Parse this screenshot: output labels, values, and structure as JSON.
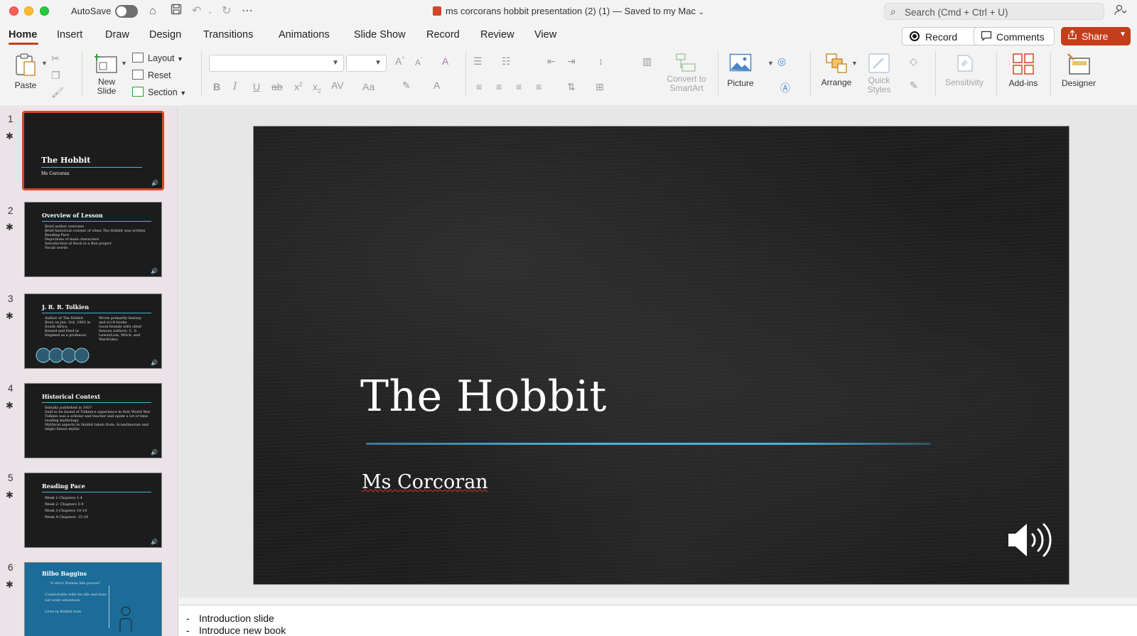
{
  "titlebar": {
    "autosave_label": "AutoSave",
    "autosave_on": false,
    "document_title": "ms corcorans hobbit presentation (2) (1)",
    "save_status": "— Saved to my Mac",
    "search_placeholder": "Search (Cmd + Ctrl + U)"
  },
  "tabs": [
    "Home",
    "Insert",
    "Draw",
    "Design",
    "Transitions",
    "Animations",
    "Slide Show",
    "Record",
    "Review",
    "View"
  ],
  "active_tab": "Home",
  "actions": {
    "record_label": "Record",
    "comments_label": "Comments",
    "share_label": "Share"
  },
  "ribbon": {
    "paste": "Paste",
    "new_slide_line1": "New",
    "new_slide_line2": "Slide",
    "layout": "Layout",
    "reset": "Reset",
    "section": "Section",
    "convert_line1": "Convert to",
    "convert_line2": "SmartArt",
    "picture": "Picture",
    "arrange": "Arrange",
    "quick_styles_line1": "Quick",
    "quick_styles_line2": "Styles",
    "sensitivity": "Sensitivity",
    "addins": "Add-ins",
    "designer": "Designer"
  },
  "slides": [
    {
      "num": "1",
      "title": "The Hobbit",
      "subtitle": "Ms Corcoran"
    },
    {
      "num": "2",
      "title": "Overview of Lesson",
      "bullets": [
        "Brief author overview",
        "Brief historical context of when The Hobbit was written",
        "Reading Pace",
        "Depictions of main characters",
        "Introduction of Book in a Box project",
        "Vocab words"
      ]
    },
    {
      "num": "3",
      "title": "J. R. R. Tolkien",
      "col1": [
        "Author of The Hobbit",
        "Born on Jan. 3rd, 1892 in South Africa",
        "Raised and Died in England as a professor."
      ],
      "col2": [
        "Wrote primarily fantasy and sci-fi books",
        "Good friends with other famous authors: C. S. Lewis(Lion, Witch, and Wardrobe)"
      ]
    },
    {
      "num": "4",
      "title": "Historical Context",
      "bullets": [
        "Initially published in 1937",
        "Said to be based of Tolkien's experience in first World War",
        "Tolkien was a scholar and teacher and spent a lot of time reading mythology.",
        "Mythical aspects in Hobbit taken from: Scandinavian and Anglo-Saxon myths"
      ]
    },
    {
      "num": "5",
      "title": "Reading Pace",
      "bullets": [
        "Week 1-Chapters 1-4",
        "Week 2- Chapters 5-9",
        "Week 3-Chapters 10-14",
        "Week 4-Chapters- 15-19"
      ]
    },
    {
      "num": "6",
      "title": "Bilbo Baggins",
      "bullets": [
        "\"A short Human like person\"",
        "Comfortable with his life and does not want adventure",
        "Lives in Hobbit hole"
      ]
    }
  ],
  "current_slide": {
    "title": "The Hobbit",
    "subtitle": "Ms Corcoran"
  },
  "notes": [
    "Introduction slide",
    "Introduce new book"
  ],
  "colors": {
    "accent": "#c43e1c",
    "slide_bg": "#1d1d1d",
    "title_rule": "#47b3e0"
  }
}
